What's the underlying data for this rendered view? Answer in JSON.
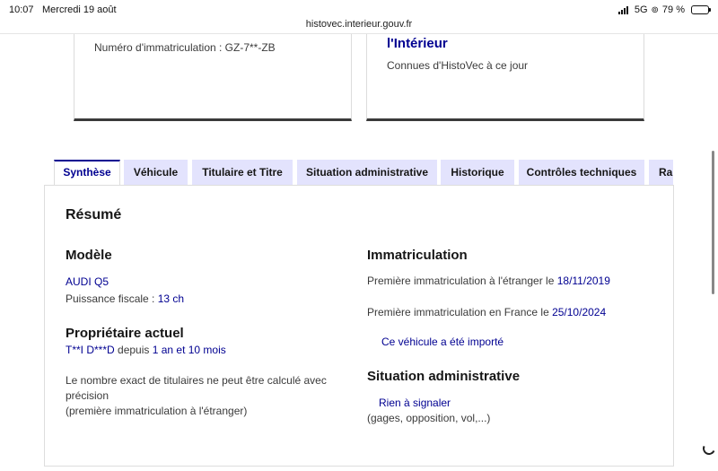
{
  "statusbar": {
    "time": "10:07",
    "date": "Mercredi 19 août",
    "network": "5G",
    "battery_text": "79 %",
    "battery_level": 0.79
  },
  "browser": {
    "url": "histovec.interieur.gouv.fr"
  },
  "cards": {
    "left": {
      "plate_text": "Numéro d'immatriculation : GZ-7**-ZB"
    },
    "right": {
      "title": "l'Intérieur",
      "subtitle": "Connues d'HistoVec à ce jour"
    }
  },
  "tabs": [
    {
      "label": "Synthèse",
      "active": true
    },
    {
      "label": "Véhicule",
      "active": false
    },
    {
      "label": "Titulaire et Titre",
      "active": false
    },
    {
      "label": "Situation administrative",
      "active": false
    },
    {
      "label": "Historique",
      "active": false
    },
    {
      "label": "Contrôles techniques",
      "active": false
    },
    {
      "label": "Rapport",
      "active": false
    }
  ],
  "summary": {
    "title": "Résumé",
    "modele": {
      "heading": "Modèle",
      "vehicle": "AUDI Q5",
      "puissance_label": "Puissance fiscale : ",
      "puissance_value": "13 ch"
    },
    "proprietaire": {
      "heading": "Propriétaire actuel",
      "name": "T**I D***D",
      "depuis_label": " depuis ",
      "depuis_value": "1 an et 10 mois",
      "note_line1": "Le nombre exact de titulaires ne peut être calculé avec",
      "note_line2": "précision",
      "note_line3": "(première immatriculation à l'étranger)"
    },
    "immatriculation": {
      "heading": "Immatriculation",
      "etranger_label": "Première immatriculation à l'étranger le ",
      "etranger_date": "18/11/2019",
      "france_label": "Première immatriculation en France le ",
      "france_date": "25/10/2024",
      "import_text": "Ce véhicule a été importé"
    },
    "situation": {
      "heading": "Situation administrative",
      "status": "Rien à signaler",
      "detail": "(gages, opposition, vol,...)"
    }
  }
}
